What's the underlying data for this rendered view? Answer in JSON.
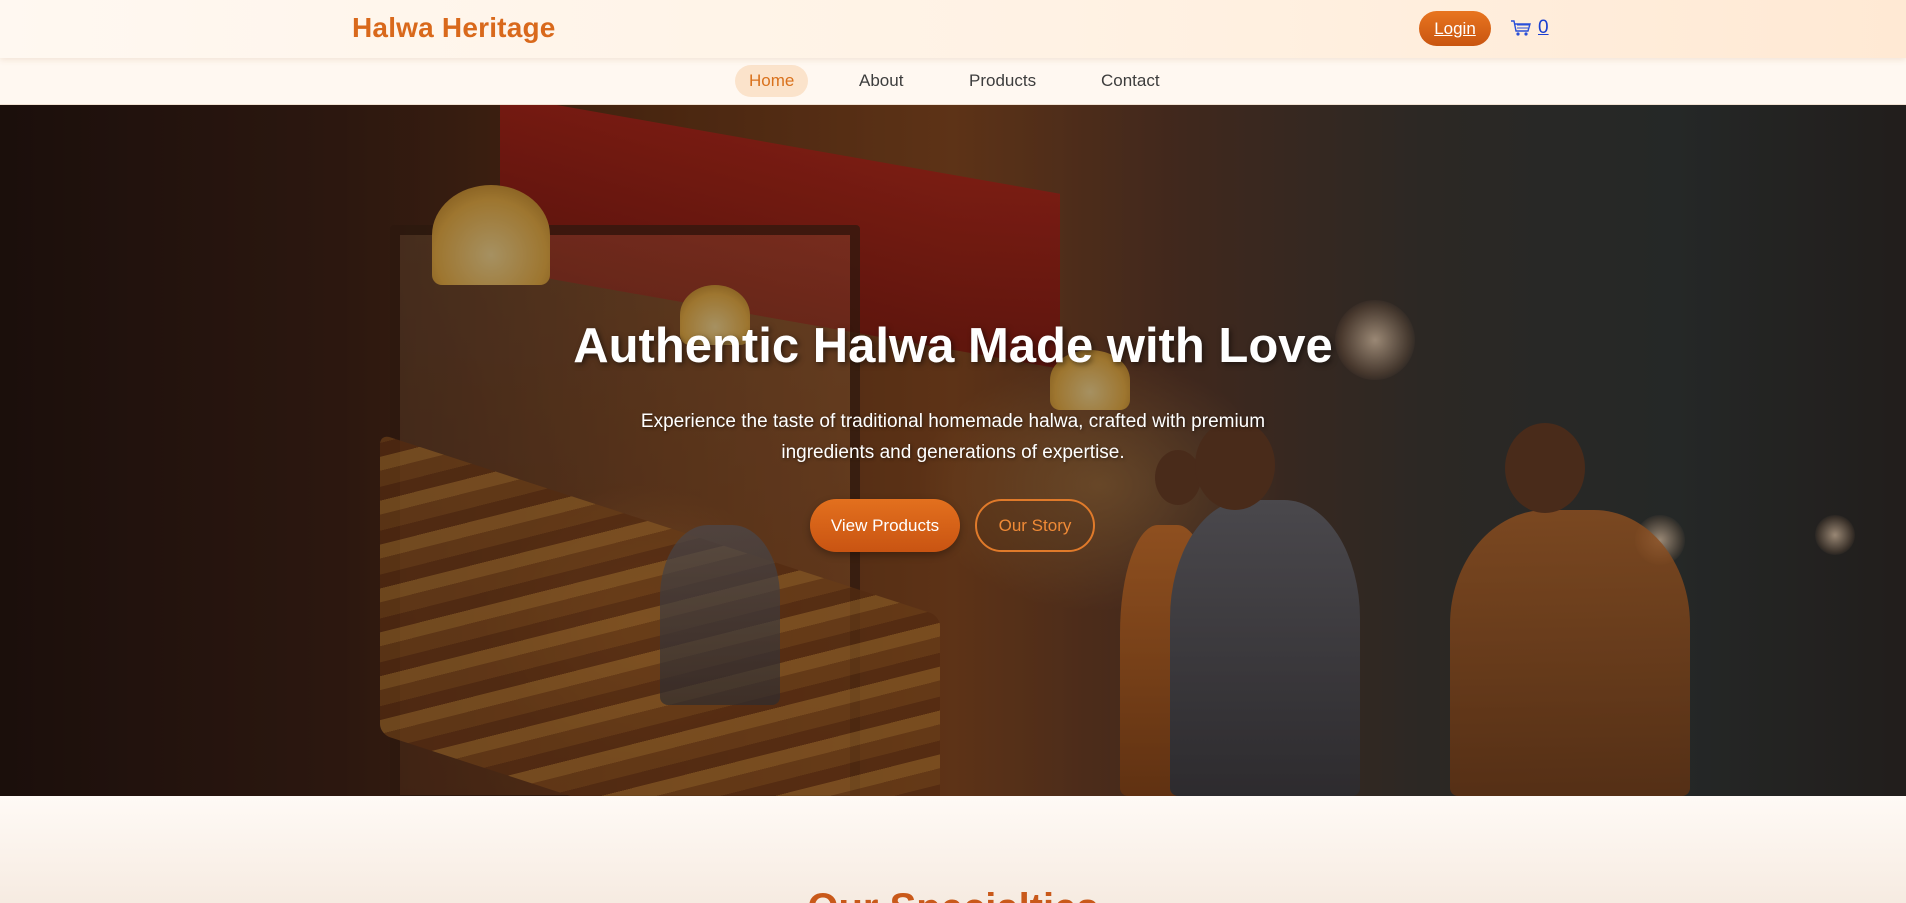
{
  "header": {
    "brand": "Halwa Heritage",
    "login_label": "Login",
    "cart_icon": "shopping-cart-icon",
    "cart_count": "0"
  },
  "nav": {
    "items": [
      {
        "label": "Home",
        "active": true
      },
      {
        "label": "About",
        "active": false
      },
      {
        "label": "Products",
        "active": false
      },
      {
        "label": "Contact",
        "active": false
      }
    ]
  },
  "hero": {
    "title": "Authentic Halwa Made with Love",
    "subtitle": "Experience the taste of traditional homemade halwa, crafted with premium ingredients and generations of expertise.",
    "primary_button": "View Products",
    "secondary_button": "Our Story"
  },
  "specialties": {
    "title": "Our Specialties"
  },
  "colors": {
    "brand": "#d9691c",
    "accent": "#e3701e",
    "cart_link": "#1a3fd0"
  }
}
